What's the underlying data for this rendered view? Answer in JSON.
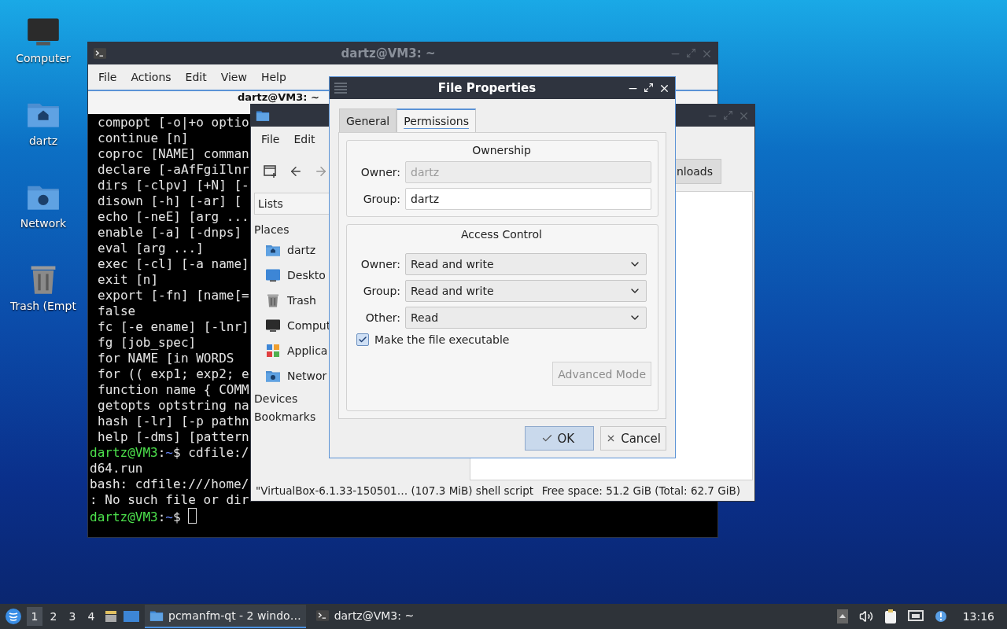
{
  "desktop_icons": [
    {
      "label": "Computer",
      "kind": "computer"
    },
    {
      "label": "dartz",
      "kind": "home"
    },
    {
      "label": "Network",
      "kind": "network"
    },
    {
      "label": "Trash (Empt",
      "kind": "trash"
    }
  ],
  "terminal": {
    "title": "dartz@VM3: ~",
    "menu": [
      "File",
      "Actions",
      "Edit",
      "View",
      "Help"
    ],
    "tab": "dartz@VM3: ~",
    "lines": [
      {
        "kind": "output",
        "text": "compopt [-o|+o optio"
      },
      {
        "kind": "output",
        "text": "continue [n]"
      },
      {
        "kind": "output",
        "text": "coproc [NAME] comman"
      },
      {
        "kind": "output",
        "text": "declare [-aAfFgiIlnr"
      },
      {
        "kind": "output",
        "text": "dirs [-clpv] [+N] [-"
      },
      {
        "kind": "output",
        "text": "disown [-h] [-ar] ["
      },
      {
        "kind": "output",
        "text": "echo [-neE] [arg ..."
      },
      {
        "kind": "output",
        "text": "enable [-a] [-dnps]"
      },
      {
        "kind": "output",
        "text": "eval [arg ...]"
      },
      {
        "kind": "output",
        "text": "exec [-cl] [-a name]"
      },
      {
        "kind": "output",
        "text": "exit [n]"
      },
      {
        "kind": "output",
        "text": "export [-fn] [name[="
      },
      {
        "kind": "output",
        "text": "false"
      },
      {
        "kind": "output",
        "text": "fc [-e ename] [-lnr]"
      },
      {
        "kind": "output",
        "text": "fg [job_spec]"
      },
      {
        "kind": "output",
        "text": "for NAME [in WORDS"
      },
      {
        "kind": "output",
        "text": "for (( exp1; exp2; e"
      },
      {
        "kind": "output",
        "text": "function name { COMM"
      },
      {
        "kind": "output",
        "text": "getopts optstring na"
      },
      {
        "kind": "output",
        "text": "hash [-lr] [-p pathn"
      },
      {
        "kind": "output",
        "text": "help [-dms] [pattern"
      },
      {
        "kind": "prompt",
        "user": "dartz@VM3",
        "sep": ":",
        "path": "~",
        "symbol": "$",
        "command": "cdfile:/",
        "cursor": false
      },
      {
        "kind": "plain",
        "text": "d64.run"
      },
      {
        "kind": "plain",
        "text": "bash: cdfile:///home/"
      },
      {
        "kind": "plain",
        "text": ": No such file or dir"
      },
      {
        "kind": "prompt",
        "user": "dartz@VM3",
        "sep": ":",
        "path": "~",
        "symbol": "$",
        "cursor": true
      }
    ]
  },
  "file_manager": {
    "menu": [
      "File",
      "Edit"
    ],
    "path_button": "nloads",
    "side_selector": "Lists",
    "sections": [
      {
        "label": "Places",
        "items": [
          {
            "label": "dartz",
            "kind": "home"
          },
          {
            "label": "Deskto",
            "kind": "desktop"
          },
          {
            "label": "Trash",
            "kind": "trash"
          },
          {
            "label": "Comput",
            "kind": "computer"
          },
          {
            "label": "Applica",
            "kind": "apps"
          },
          {
            "label": "Networ",
            "kind": "network"
          }
        ]
      },
      {
        "label": "Devices"
      },
      {
        "label": "Bookmarks"
      }
    ],
    "status_left": "\"VirtualBox-6.1.33-150501… (107.3 MiB) shell script",
    "status_right": "Free space: 51.2 GiB (Total: 62.7 GiB)"
  },
  "dialog": {
    "title": "File Properties",
    "tabs": [
      {
        "label": "General",
        "selected": false
      },
      {
        "label": "Permissions",
        "selected": true
      }
    ],
    "ownership": {
      "title": "Ownership",
      "fields": [
        {
          "label": "Owner:",
          "value": "dartz",
          "disabled": true
        },
        {
          "label": "Group:",
          "value": "dartz",
          "disabled": false
        }
      ]
    },
    "access": {
      "title": "Access Control",
      "selects": [
        {
          "label": "Owner:",
          "value": "Read and write"
        },
        {
          "label": "Group:",
          "value": "Read and write"
        },
        {
          "label": "Other:",
          "value": "Read"
        }
      ],
      "executable": {
        "label": "Make the file executable",
        "checked": true
      },
      "advanced": {
        "label": "Advanced Mode",
        "disabled": true
      }
    },
    "buttons": [
      {
        "label": "OK",
        "kind": "ok"
      },
      {
        "label": "Cancel",
        "kind": "cancel"
      }
    ]
  },
  "taskbar": {
    "workspaces": [
      {
        "label": "1",
        "selected": true
      },
      {
        "label": "2",
        "selected": false
      },
      {
        "label": "3",
        "selected": false
      },
      {
        "label": "4",
        "selected": false
      }
    ],
    "tasks": [
      {
        "label": "pcmanfm-qt - 2 windo…",
        "kind": "folder",
        "selected": true
      },
      {
        "label": "dartz@VM3: ~",
        "kind": "terminal",
        "selected": false
      }
    ],
    "clock": "13:16"
  }
}
